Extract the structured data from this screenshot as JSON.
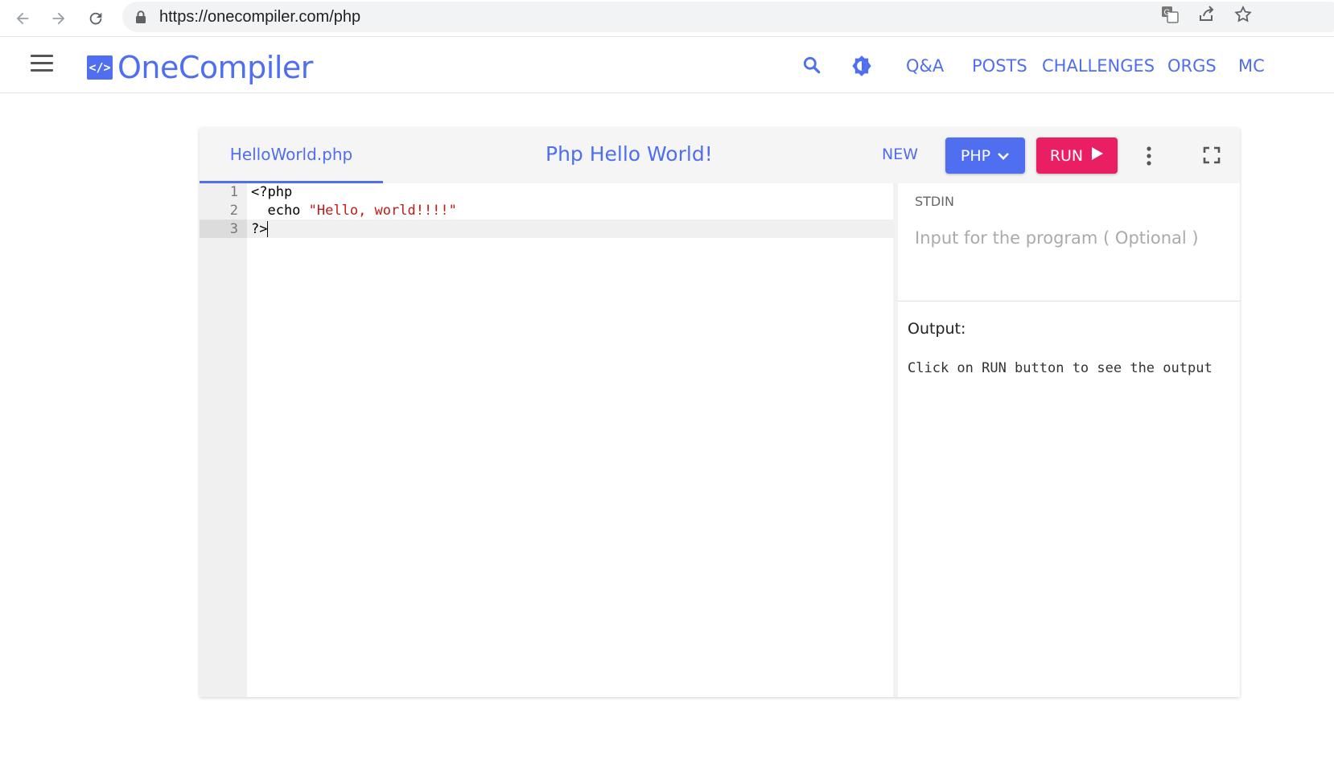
{
  "browser": {
    "url": "https://onecompiler.com/php"
  },
  "site": {
    "logo_mark": "</>",
    "logo_text": "OneCompiler",
    "nav": [
      "Q&A",
      "POSTS",
      "CHALLENGES",
      "ORGS",
      "MC"
    ]
  },
  "editor": {
    "file_tab": "HelloWorld.php",
    "title": "Php Hello World!",
    "new_label": "NEW",
    "language": "PHP",
    "run_label": "RUN",
    "line_numbers": [
      "1",
      "2",
      "3"
    ],
    "code": {
      "line1": "<?php",
      "line2_prefix": "  echo ",
      "line2_string": "\"Hello, world!!!!\"",
      "line3": "?>"
    }
  },
  "io": {
    "stdin_label": "STDIN",
    "stdin_placeholder": "Input for the program ( Optional )",
    "output_label": "Output:",
    "output_text": "Click on RUN button to see the output"
  },
  "colors": {
    "accent": "#4f6ef0",
    "run": "#e91e63",
    "string": "#c41a16"
  }
}
